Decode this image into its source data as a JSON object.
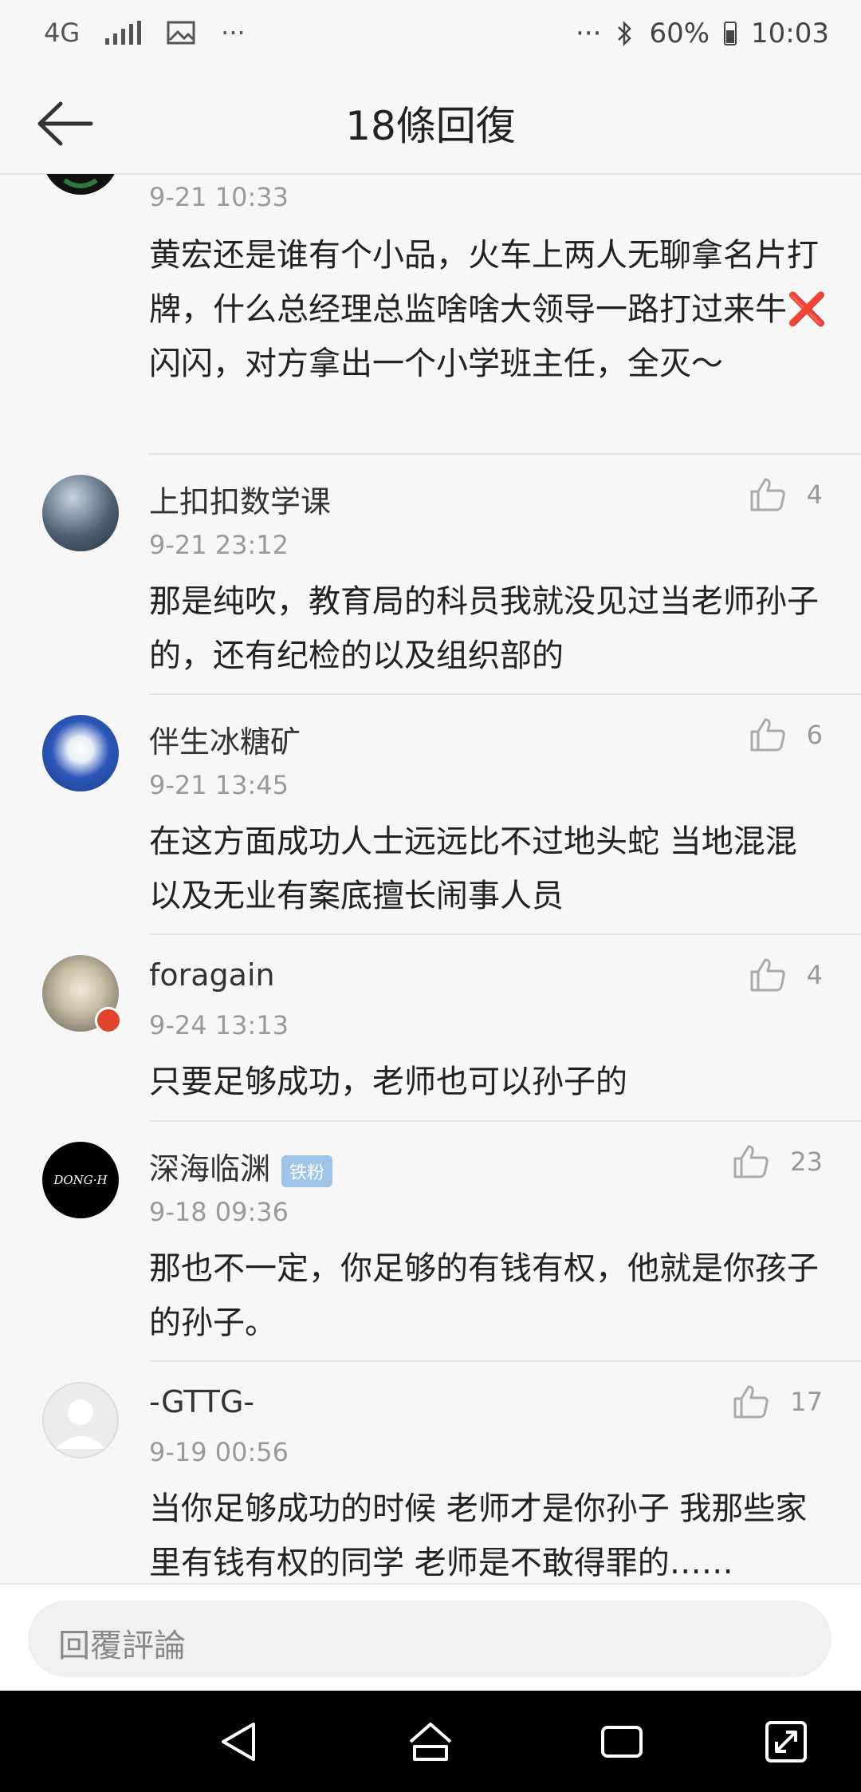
{
  "status_bar": {
    "network": "4G",
    "more": "···",
    "battery": "60%",
    "time": "10:03"
  },
  "header": {
    "title": "18條回復"
  },
  "comments": [
    {
      "time": "9-21 10:33",
      "text": "黄宏还是谁有个小品，火车上两人无聊拿名片打牌，什么总经理总监啥啥大领导一路打过来牛❌闪闪，对方拿出一个小学班主任，全灭～"
    },
    {
      "name": "上扣扣数学课",
      "likes": "4",
      "time": "9-21 23:12",
      "text": "那是纯吹，教育局的科员我就没见过当老师孙子的，还有纪检的以及组织部的"
    },
    {
      "name": "伴生冰糖矿",
      "likes": "6",
      "time": "9-21 13:45",
      "text": "在这方面成功人士远远比不过地头蛇 当地混混 以及无业有案底擅长闹事人员"
    },
    {
      "name": "foragain",
      "likes": "4",
      "time": "9-24 13:13",
      "text": "只要足够成功，老师也可以孙子的"
    },
    {
      "name": "深海临渊",
      "badge": "铁粉",
      "likes": "23",
      "time": "9-18 09:36",
      "avatar_text": "DONG·H",
      "text": "那也不一定，你足够的有钱有权，他就是你孩子的孙子。"
    },
    {
      "name": "-GTTG-",
      "likes": "17",
      "time": "9-19 00:56",
      "text": "当你足够成功的时候 老师才是你孙子 我那些家里有钱有权的同学 老师是不敢得罪的……"
    }
  ],
  "reply": {
    "placeholder": "回覆評論"
  },
  "icons": [
    "back-arrow-icon",
    "thumbs-up-icon",
    "nav-back-icon",
    "nav-home-icon",
    "nav-recents-icon",
    "nav-expand-icon"
  ]
}
